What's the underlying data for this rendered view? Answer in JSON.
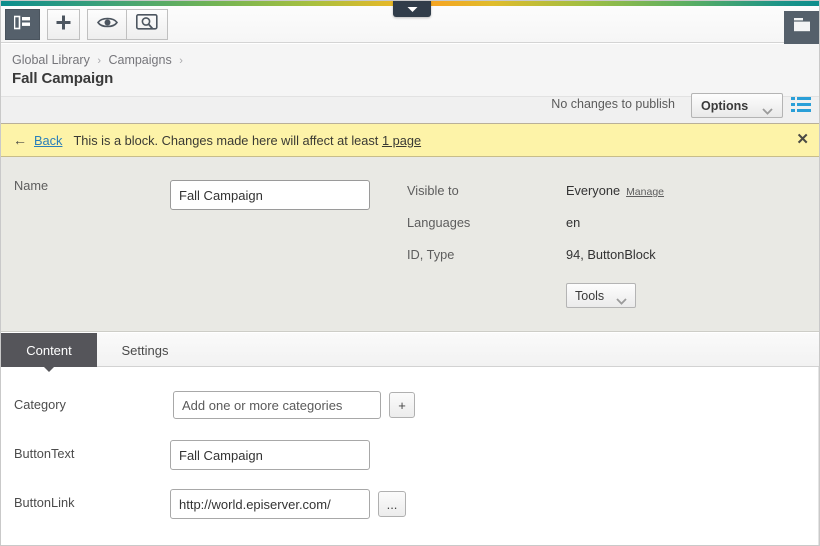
{
  "window": {
    "gradient_colors": [
      "#0c8d8d",
      "#72b455",
      "#f5a623",
      "#5aae63",
      "#0c8d8d"
    ],
    "pull_tab_icon": "chevron-down-icon"
  },
  "toolbar": {
    "nav_toggle_icon": "navigation-tree-icon",
    "add_label": "+",
    "preview_icon": "eye-icon",
    "view_icon": "screen-search-icon",
    "assets_icon": "assets-folder-icon"
  },
  "header": {
    "breadcrumb": [
      {
        "label": "Global Library"
      },
      {
        "label": "Campaigns"
      }
    ],
    "breadcrumb_separator": "›",
    "title": "Fall Campaign",
    "publish_status": "No changes to publish",
    "options_label": "Options",
    "options_caret_icon": "chevron-down-icon",
    "list_toggle_icon": "list-view-icon",
    "list_toggle_color": "#2a9fd8"
  },
  "notice": {
    "back_arrow_icon": "arrow-left-icon",
    "back_label": "Back",
    "text_before": "This is a block. Changes made here will affect at least",
    "link_label": "1 page",
    "close_icon": "close-icon",
    "background": "#fdf3a8"
  },
  "meta": {
    "name_label": "Name",
    "name_value": "Fall Campaign",
    "rows": [
      {
        "key": "Visible to",
        "value": "Everyone",
        "action": "Manage"
      },
      {
        "key": "Languages",
        "value": "en",
        "action": ""
      },
      {
        "key": "ID, Type",
        "value": "94, ButtonBlock",
        "action": ""
      }
    ],
    "tools_label": "Tools",
    "tools_caret_icon": "chevron-down-icon"
  },
  "tabs": [
    {
      "label": "Content",
      "active": true
    },
    {
      "label": "Settings",
      "active": false
    }
  ],
  "form": {
    "category": {
      "label": "Category",
      "value": "",
      "placeholder": "Add one or more categories",
      "add_button": "+"
    },
    "button_text": {
      "label": "ButtonText",
      "value": "Fall Campaign"
    },
    "button_link": {
      "label": "ButtonLink",
      "value": "http://world.episerver.com/",
      "browse_button": "..."
    }
  }
}
